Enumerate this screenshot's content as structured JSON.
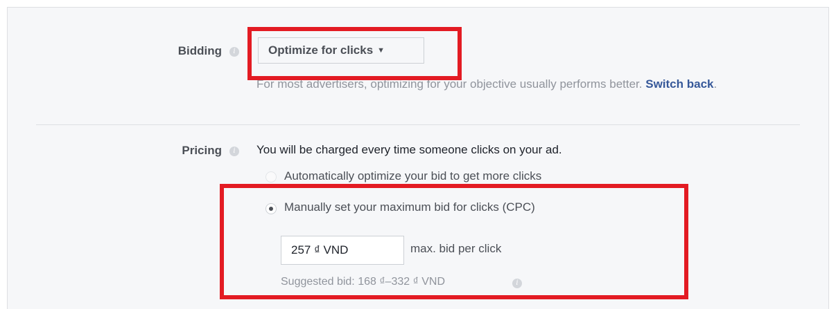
{
  "bidding": {
    "label": "Bidding",
    "info_icon": "info-icon",
    "dropdown_value": "Optimize for clicks",
    "caret_icon": "caret-down-icon",
    "helper_text": "For most advertisers, optimizing for your objective usually performs better.",
    "switch_back_link": "Switch back",
    "helper_end": "."
  },
  "pricing": {
    "label": "Pricing",
    "info_icon": "info-icon",
    "description": "You will be charged every time someone clicks on your ad.",
    "options": [
      {
        "label": "Automatically optimize your bid to get more clicks",
        "selected": false
      },
      {
        "label": "Manually set your maximum bid for clicks (CPC)",
        "selected": true
      }
    ],
    "bid_value": "257 ₫ VND",
    "bid_suffix": "max. bid per click",
    "suggested_bid": "Suggested bid: 168 ₫–332 ₫ VND"
  },
  "colors": {
    "highlight": "#e31b23",
    "link": "#365899",
    "panel_bg": "#f6f7f9"
  }
}
